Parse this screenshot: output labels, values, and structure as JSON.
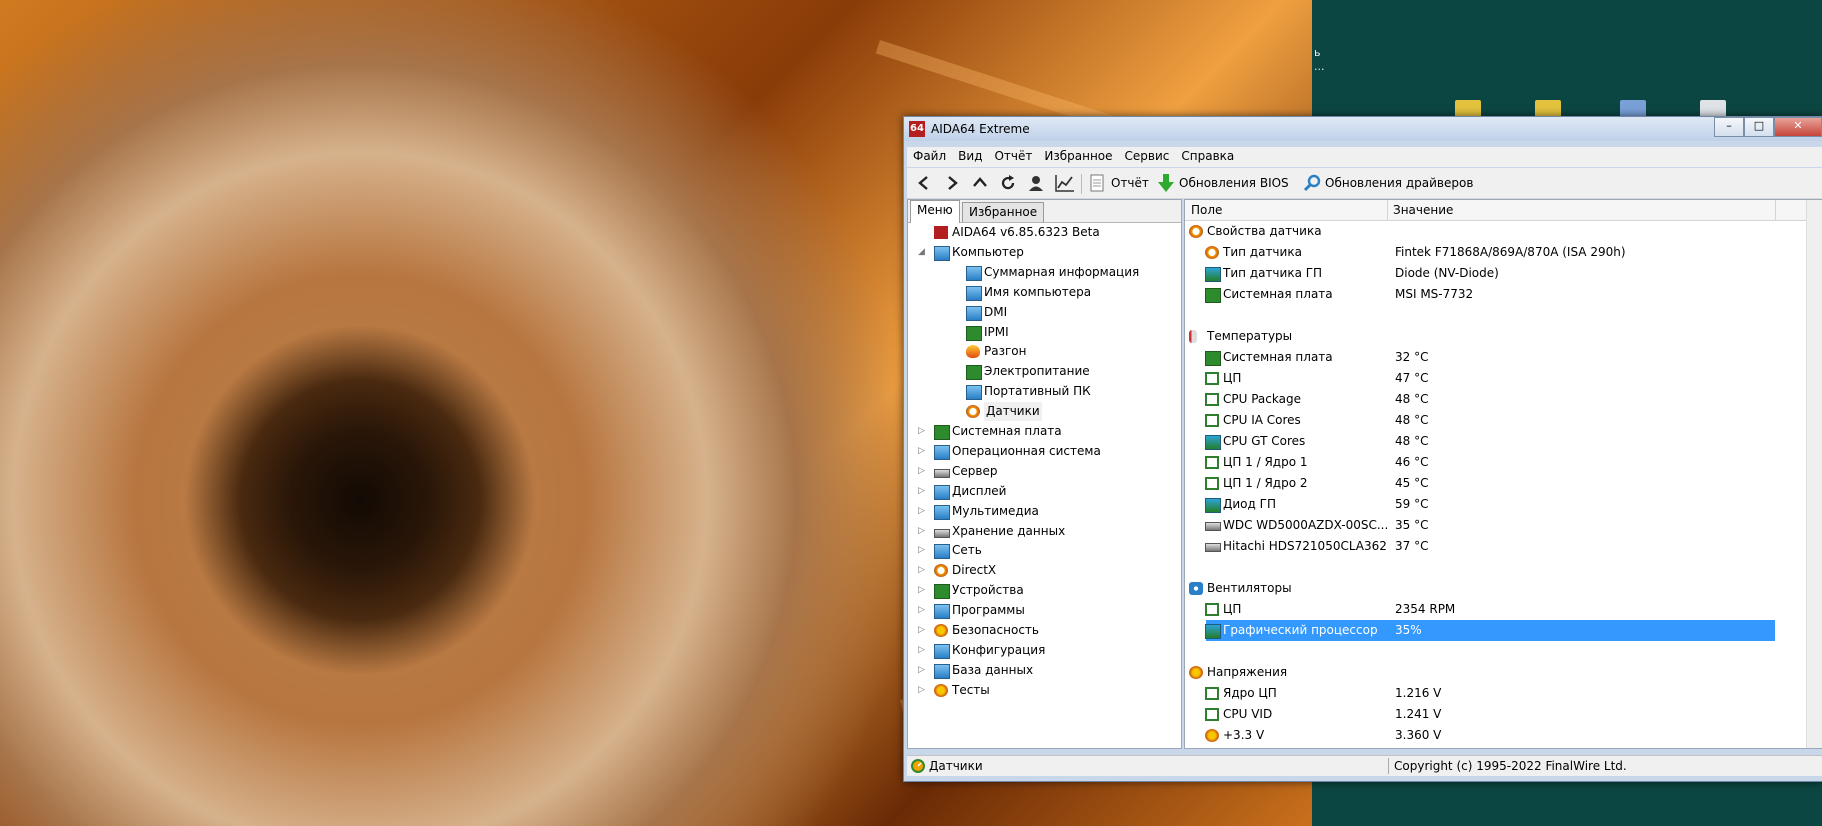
{
  "window": {
    "title": "AIDA64 Extreme",
    "app_icon_text": "64",
    "controls": [
      "minimize",
      "maximize",
      "close"
    ]
  },
  "desktop": {
    "right_side_text": [
      "ь",
      "..."
    ]
  },
  "menubar": [
    "Файл",
    "Вид",
    "Отчёт",
    "Избранное",
    "Сервис",
    "Справка"
  ],
  "toolbar": {
    "nav_icons": [
      "back-icon",
      "forward-icon",
      "up-icon",
      "refresh-icon",
      "user-icon",
      "chart-icon"
    ],
    "report_label": "Отчёт",
    "bios_label": "Обновления BIOS",
    "drivers_label": "Обновления драйверов"
  },
  "tabs": [
    "Меню",
    "Избранное"
  ],
  "tree": [
    {
      "label": "AIDA64 v6.85.6323 Beta",
      "level": 0,
      "icon": "aida-icon",
      "arrow": ""
    },
    {
      "label": "Компьютер",
      "level": 0,
      "icon": "computer-icon",
      "arrow": "◢"
    },
    {
      "label": "Суммарная информация",
      "level": 1,
      "icon": "monitor-icon",
      "arrow": ""
    },
    {
      "label": "Имя компьютера",
      "level": 1,
      "icon": "monitor-icon",
      "arrow": ""
    },
    {
      "label": "DMI",
      "level": 1,
      "icon": "monitor-icon",
      "arrow": ""
    },
    {
      "label": "IPMI",
      "level": 1,
      "icon": "phone-icon",
      "arrow": ""
    },
    {
      "label": "Разгон",
      "level": 1,
      "icon": "flame-icon",
      "arrow": ""
    },
    {
      "label": "Электропитание",
      "level": 1,
      "icon": "plug-icon",
      "arrow": ""
    },
    {
      "label": "Портативный ПК",
      "level": 1,
      "icon": "monitor-icon",
      "arrow": ""
    },
    {
      "label": "Датчики",
      "level": 1,
      "icon": "gauge-icon",
      "arrow": "",
      "selected": true
    },
    {
      "label": "Системная плата",
      "level": 0,
      "icon": "board-icon",
      "arrow": "▷"
    },
    {
      "label": "Операционная система",
      "level": 0,
      "icon": "windows-icon",
      "arrow": "▷"
    },
    {
      "label": "Сервер",
      "level": 0,
      "icon": "server-icon",
      "arrow": "▷"
    },
    {
      "label": "Дисплей",
      "level": 0,
      "icon": "monitor-icon",
      "arrow": "▷"
    },
    {
      "label": "Мультимедиа",
      "level": 0,
      "icon": "speaker-icon",
      "arrow": "▷"
    },
    {
      "label": "Хранение данных",
      "level": 0,
      "icon": "hdd-icon",
      "arrow": "▷"
    },
    {
      "label": "Сеть",
      "level": 0,
      "icon": "network-icon",
      "arrow": "▷"
    },
    {
      "label": "DirectX",
      "level": 0,
      "icon": "xbox-icon",
      "arrow": "▷"
    },
    {
      "label": "Устройства",
      "level": 0,
      "icon": "device-icon",
      "arrow": "▷"
    },
    {
      "label": "Программы",
      "level": 0,
      "icon": "programs-icon",
      "arrow": "▷"
    },
    {
      "label": "Безопасность",
      "level": 0,
      "icon": "shield-icon",
      "arrow": "▷"
    },
    {
      "label": "Конфигурация",
      "level": 0,
      "icon": "config-icon",
      "arrow": "▷"
    },
    {
      "label": "База данных",
      "level": 0,
      "icon": "database-icon",
      "arrow": "▷"
    },
    {
      "label": "Тесты",
      "level": 0,
      "icon": "tests-icon",
      "arrow": "▷"
    }
  ],
  "columns": {
    "field": "Поле",
    "value": "Значение"
  },
  "rows": [
    {
      "type": "group",
      "field": "Свойства датчика",
      "icon": "gauge-icon"
    },
    {
      "type": "item",
      "field": "Тип датчика",
      "value": "Fintek F71868A/869A/870A  (ISA 290h)",
      "icon": "gauge-icon"
    },
    {
      "type": "item",
      "field": "Тип датчика ГП",
      "value": "Diode  (NV-Diode)",
      "icon": "gpu-icon"
    },
    {
      "type": "item",
      "field": "Системная плата",
      "value": "MSI MS-7732",
      "icon": "board-icon"
    },
    {
      "type": "blank"
    },
    {
      "type": "group",
      "field": "Температуры",
      "icon": "thermometer-icon"
    },
    {
      "type": "item",
      "field": "Системная плата",
      "value": "32 °C",
      "icon": "board-icon"
    },
    {
      "type": "item",
      "field": "ЦП",
      "value": "47 °C",
      "icon": "chip-icon"
    },
    {
      "type": "item",
      "field": "CPU Package",
      "value": "48 °C",
      "icon": "chip-icon"
    },
    {
      "type": "item",
      "field": "CPU IA Cores",
      "value": "48 °C",
      "icon": "chip-icon"
    },
    {
      "type": "item",
      "field": "CPU GT Cores",
      "value": "48 °C",
      "icon": "gpu-icon"
    },
    {
      "type": "item",
      "field": "ЦП 1 / Ядро 1",
      "value": "46 °C",
      "icon": "chip-icon"
    },
    {
      "type": "item",
      "field": "ЦП 1 / Ядро 2",
      "value": "45 °C",
      "icon": "chip-icon"
    },
    {
      "type": "item",
      "field": "Диод ГП",
      "value": "59 °C",
      "icon": "gpu-icon"
    },
    {
      "type": "item",
      "field": "WDC WD5000AZDX-00SC...",
      "value": "35 °C",
      "icon": "hdd-icon"
    },
    {
      "type": "item",
      "field": "Hitachi HDS721050CLA362",
      "value": "37 °C",
      "icon": "hdd-icon"
    },
    {
      "type": "blank"
    },
    {
      "type": "group",
      "field": "Вентиляторы",
      "icon": "fan-icon"
    },
    {
      "type": "item",
      "field": "ЦП",
      "value": "2354 RPM",
      "icon": "chip-icon"
    },
    {
      "type": "item",
      "field": "Графический процессор",
      "value": "35%",
      "icon": "gpu-icon",
      "selected": true
    },
    {
      "type": "blank"
    },
    {
      "type": "group",
      "field": "Напряжения",
      "icon": "voltage-icon"
    },
    {
      "type": "item",
      "field": "Ядро ЦП",
      "value": "1.216 V",
      "icon": "chip-icon"
    },
    {
      "type": "item",
      "field": "CPU VID",
      "value": "1.241 V",
      "icon": "chip-icon"
    },
    {
      "type": "item",
      "field": "+3.3 V",
      "value": "3.360 V",
      "icon": "voltage-icon"
    }
  ],
  "status": {
    "left": "Датчики",
    "right": "Copyright (c) 1995-2022 FinalWire Ltd."
  }
}
